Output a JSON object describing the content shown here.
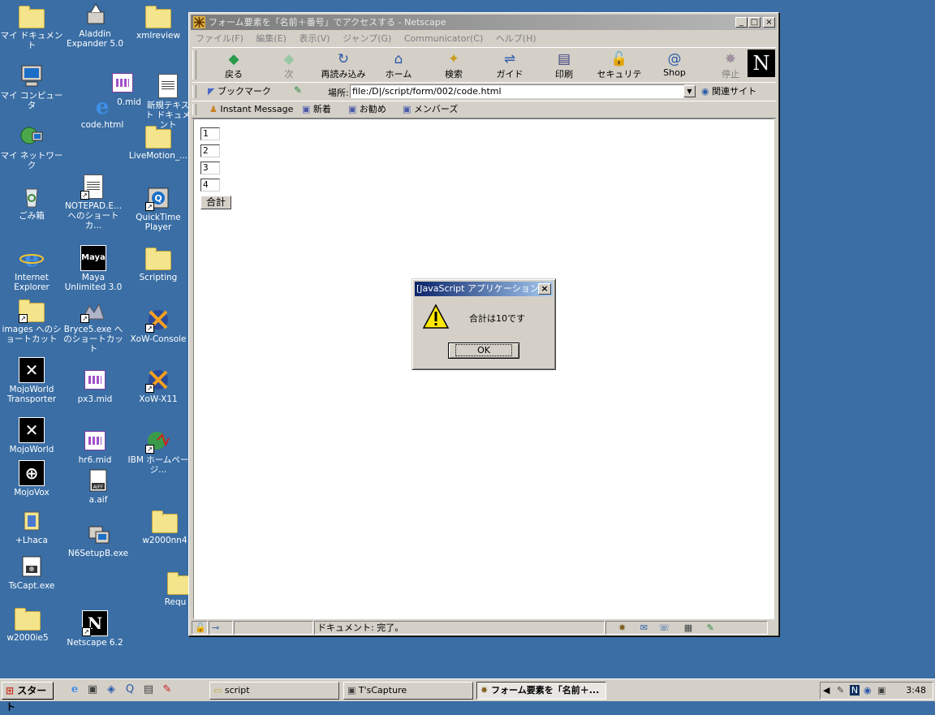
{
  "desktop": {
    "icons": [
      {
        "label": "マイ ドキュメント"
      },
      {
        "label": "マイ コンピュータ"
      },
      {
        "label": "マイ ネットワーク"
      },
      {
        "label": "ごみ箱"
      },
      {
        "label": "Internet Explorer"
      },
      {
        "label": "images へのショートカット"
      },
      {
        "label": "MojoWorld Transporter"
      },
      {
        "label": "MojoWorld"
      },
      {
        "label": "MojoVox"
      },
      {
        "label": "+Lhaca"
      },
      {
        "label": "TsCapt.exe"
      },
      {
        "label": "w2000ie5"
      },
      {
        "label": "Aladdin Expander 5.0"
      },
      {
        "label": "code.html"
      },
      {
        "label": "NOTEPAD.E... へのショートカ..."
      },
      {
        "label": "Maya Unlimited 3.0"
      },
      {
        "label": "Bryce5.exe へのショートカット"
      },
      {
        "label": "px3.mid"
      },
      {
        "label": "hr6.mid"
      },
      {
        "label": "a.aif"
      },
      {
        "label": "N6SetupB.exe"
      },
      {
        "label": "Netscape 6.2"
      },
      {
        "label": "xmlreview"
      },
      {
        "label": "LiveMotion_..."
      },
      {
        "label": "QuickTime Player"
      },
      {
        "label": "Scripting"
      },
      {
        "label": "XoW-Console"
      },
      {
        "label": "XoW-X11"
      },
      {
        "label": "IBM ホームページ..."
      },
      {
        "label": "w2000nn4"
      },
      {
        "label": "Requ"
      },
      {
        "label": "0.mid"
      },
      {
        "label": "新規テキスト ドキュメント"
      }
    ]
  },
  "window": {
    "title": "フォーム要素を「名前＋番号」でアクセスする - Netscape",
    "controls": {
      "minimize": "_",
      "maximize": "□",
      "close": "×"
    },
    "menu": [
      "ファイル(F)",
      "編集(E)",
      "表示(V)",
      "ジャンプ(G)",
      "Communicator(C)",
      "ヘルプ(H)"
    ],
    "nav": [
      {
        "label": "戻る",
        "icon": "back-arrow-icon"
      },
      {
        "label": "次",
        "icon": "forward-arrow-icon"
      },
      {
        "label": "再読み込み",
        "icon": "reload-icon"
      },
      {
        "label": "ホーム",
        "icon": "home-icon"
      },
      {
        "label": "検索",
        "icon": "search-icon"
      },
      {
        "label": "ガイド",
        "icon": "guide-icon"
      },
      {
        "label": "印刷",
        "icon": "print-icon"
      },
      {
        "label": "セキュリティ",
        "icon": "lock-icon"
      },
      {
        "label": "Shop",
        "icon": "shop-icon"
      },
      {
        "label": "停止",
        "icon": "stop-icon"
      }
    ],
    "logo": "N",
    "bookmarks_label": "ブックマーク",
    "location_label": "場所:",
    "location_value": "file:/D|/script/form/002/code.html",
    "related_label": "関連サイト",
    "personal": [
      "Instant Message",
      "新着",
      "お勧め",
      "メンバーズ"
    ],
    "status": "ドキュメント: 完了。"
  },
  "page": {
    "inputs": [
      "1",
      "2",
      "3",
      "4"
    ],
    "button": "合計"
  },
  "dialog": {
    "title": "[JavaScript アプリケーション]",
    "message": "合計は10です",
    "ok": "OK"
  },
  "taskbar": {
    "start": "スタート",
    "tasks": [
      {
        "label": "script"
      },
      {
        "label": "T'sCapture"
      },
      {
        "label": "フォーム要素を「名前＋..."
      }
    ],
    "clock": "3:48"
  },
  "colors": {
    "desktop": "#3a6ea5",
    "face": "#d4d0c8",
    "dialog_title": "#0a246a"
  }
}
